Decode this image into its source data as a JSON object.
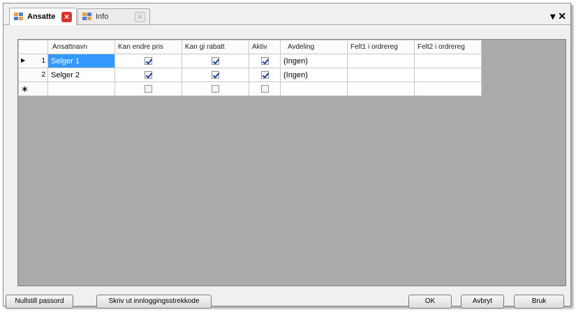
{
  "tabs": [
    {
      "label": "Ansatte",
      "active": true
    },
    {
      "label": "Info",
      "active": false
    }
  ],
  "window_controls": {
    "menu_glyph": "▾",
    "close_glyph": "✕"
  },
  "grid": {
    "columns": [
      "Ansattnavn",
      "Kan endre pris",
      "Kan gi rabatt",
      "Aktiv",
      "Avdeling",
      "Felt1 i ordrereg",
      "Felt2 i ordrereg"
    ],
    "rows": [
      {
        "num": "1",
        "name": "Selger 1",
        "kan_endre_pris": true,
        "kan_gi_rabatt": true,
        "aktiv": true,
        "avdeling": "(Ingen)",
        "felt1": "",
        "felt2": "",
        "current": true
      },
      {
        "num": "2",
        "name": "Selger 2",
        "kan_endre_pris": true,
        "kan_gi_rabatt": true,
        "aktiv": true,
        "avdeling": "(Ingen)",
        "felt1": "",
        "felt2": "",
        "current": false
      }
    ],
    "new_row_marker": "∗"
  },
  "buttons": {
    "reset_password": "Nullstill passord",
    "print_barcode": "Skriv ut innloggingsstrekkode",
    "ok": "OK",
    "cancel": "Avbryt",
    "apply": "Bruk"
  },
  "colors": {
    "selection": "#3399ff",
    "grid_background": "#ababab",
    "tab_close": "#d6342c"
  }
}
